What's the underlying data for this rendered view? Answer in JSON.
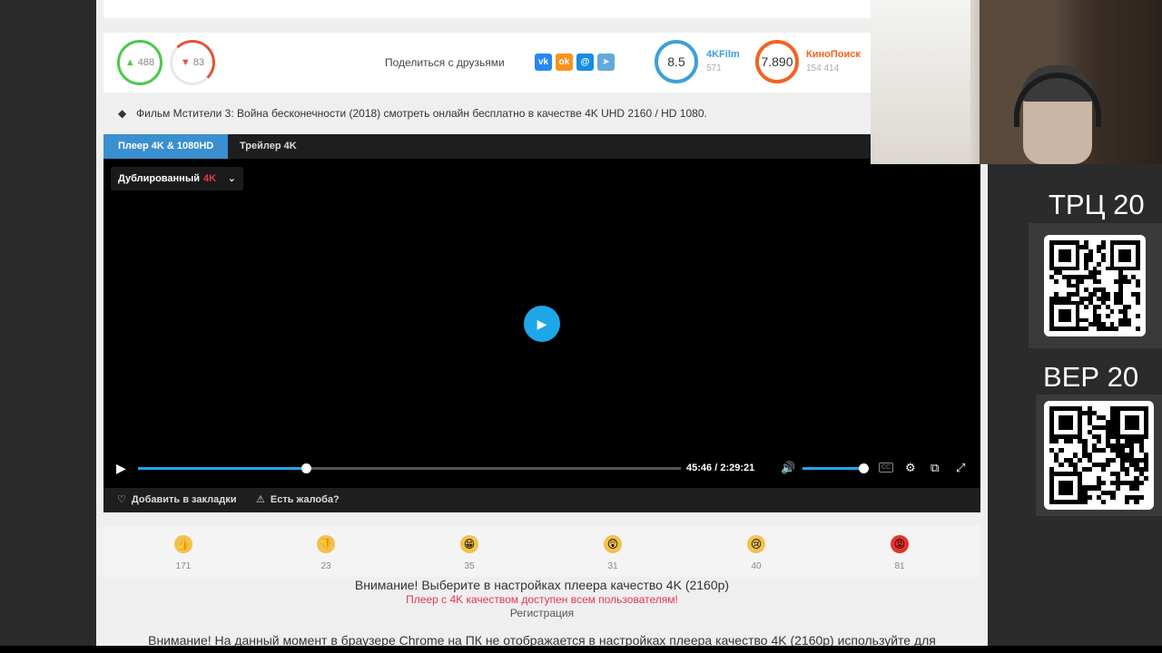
{
  "ratings": {
    "likes": "488",
    "dislikes": "83",
    "like_fraction": 1.0,
    "dislike_fraction": 0.15
  },
  "share": {
    "label": "Поделиться с друзьями",
    "networks": [
      {
        "icon": "vk-icon",
        "glyph": "vk"
      },
      {
        "icon": "odnoklassniki-icon",
        "glyph": "ok"
      },
      {
        "icon": "mailru-icon",
        "glyph": "@"
      },
      {
        "icon": "telegram-icon",
        "glyph": "➤"
      }
    ]
  },
  "scores": {
    "film": {
      "value": "8.5",
      "name": "4KFilm",
      "votes": "571",
      "color": "#3f9fd8"
    },
    "kp": {
      "value": "7.890",
      "name": "КиноПоиск",
      "votes": "154 414",
      "color": "#f26322"
    }
  },
  "tags_text": "Фильм Мстители 3: Война бесконечности (2018) смотреть онлайн бесплатно в качестве 4K UHD 2160 / HD 1080.",
  "player": {
    "tabs": [
      "Плеер 4K & 1080HD",
      "Трейлер 4K"
    ],
    "dub_label": "Дублированный",
    "dub_quality": "4K",
    "current_time": "45:46",
    "separator": "/",
    "duration": "2:29:21",
    "progress_fraction": 0.31,
    "volume_fraction": 0.96,
    "accent_color": "#1ea7e8",
    "cc_label": "CC"
  },
  "player_footer": {
    "bookmark": "Добавить в закладки",
    "complaint": "Есть жалоба?"
  },
  "reactions": [
    {
      "icon": "thumbs-up-icon",
      "glyph": "👍",
      "count": "171",
      "color": "#f2c14e"
    },
    {
      "icon": "thumbs-down-icon",
      "glyph": "👎",
      "count": "23",
      "color": "#f2c14e"
    },
    {
      "icon": "laughing-face-icon",
      "glyph": "😁",
      "count": "35",
      "color": "#f2c14e"
    },
    {
      "icon": "shocked-face-icon",
      "glyph": "😲",
      "count": "31",
      "color": "#f2c14e"
    },
    {
      "icon": "sad-face-icon",
      "glyph": "😢",
      "count": "40",
      "color": "#f2c14e"
    },
    {
      "icon": "angry-face-icon",
      "glyph": "😡",
      "count": "81",
      "color": "#e5332a"
    }
  ],
  "notices": {
    "quality_hint": "Внимание! Выберите в настройках плеера качество 4K (2160p)",
    "availability": "Плеер с 4K качеством доступен всем пользователям!",
    "register": "Регистрация",
    "chrome_warning": "Внимание! На данный момент в браузере Chrome на ПК не отображается в настройках плеера качество 4K (2160p) используйте для"
  },
  "overlay": {
    "qr1_title": "ТРЦ 20",
    "qr2_title": "ВЕР 20"
  }
}
